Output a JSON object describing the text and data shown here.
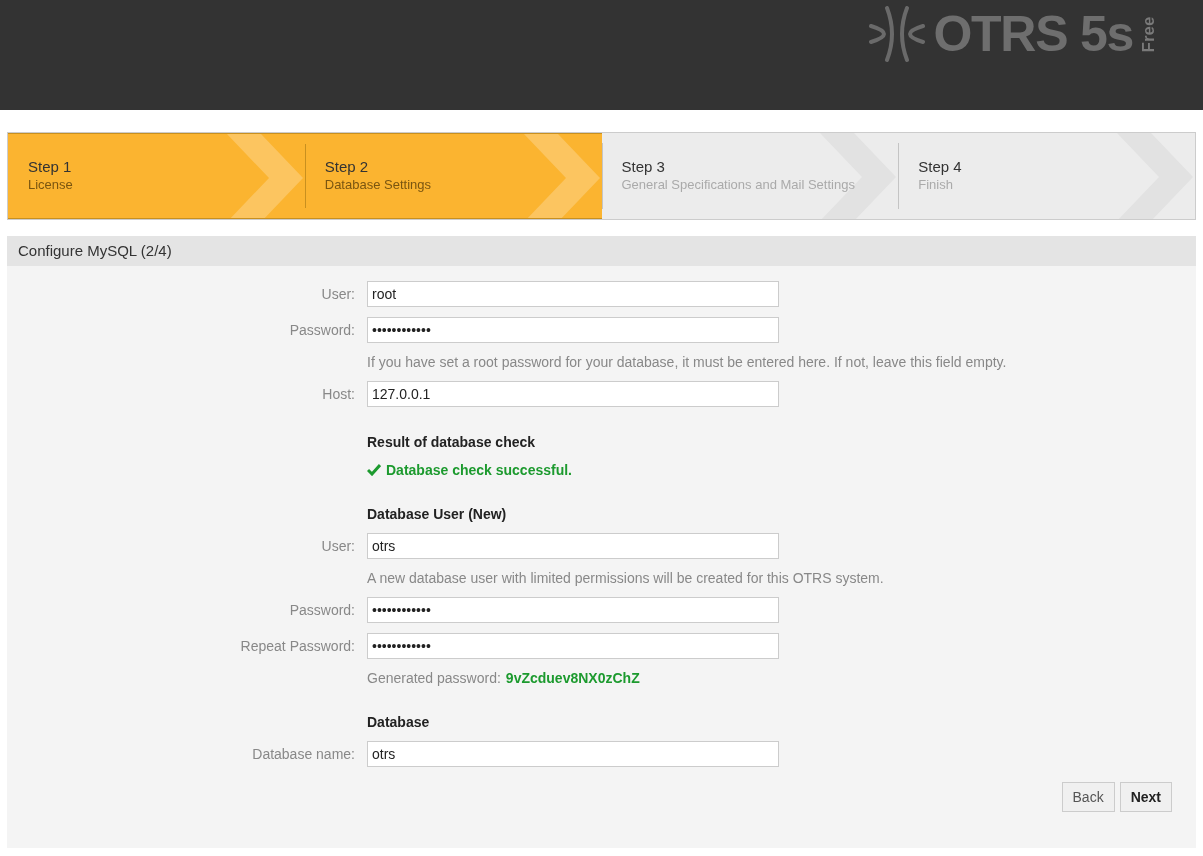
{
  "header": {
    "logo": {
      "name": "OTRS 5s",
      "edition": "Free"
    }
  },
  "steps": [
    {
      "title": "Step 1",
      "subtitle": "License",
      "active": true
    },
    {
      "title": "Step 2",
      "subtitle": "Database Settings",
      "active": true
    },
    {
      "title": "Step 3",
      "subtitle": "General Specifications and Mail Settings",
      "active": false
    },
    {
      "title": "Step 4",
      "subtitle": "Finish",
      "active": false
    }
  ],
  "panel": {
    "title": "Configure MySQL (2/4)",
    "items": [
      {
        "kind": "field",
        "label": "User:",
        "value": "root"
      },
      {
        "kind": "field",
        "label": "Password:",
        "value": "••••••••••••"
      },
      {
        "kind": "hint",
        "text": "If you have set a root password for your database, it must be entered here. If not, leave this field empty."
      },
      {
        "kind": "field",
        "label": "Host:",
        "value": "127.0.0.1"
      },
      {
        "kind": "heading",
        "text": "Result of database check"
      },
      {
        "kind": "status",
        "text": "Database check successful."
      },
      {
        "kind": "heading",
        "text": "Database User (New)"
      },
      {
        "kind": "field",
        "label": "User:",
        "value": "otrs"
      },
      {
        "kind": "hint",
        "text": "A new database user with limited permissions will be created for this OTRS system."
      },
      {
        "kind": "field",
        "label": "Password:",
        "value": "••••••••••••"
      },
      {
        "kind": "field",
        "label": "Repeat Password:",
        "value": "••••••••••••"
      },
      {
        "kind": "generated",
        "text": "Generated password:",
        "password": "9vZcduev8NX0zChZ"
      },
      {
        "kind": "heading",
        "text": "Database"
      },
      {
        "kind": "field",
        "label": "Database name:",
        "value": "otrs"
      }
    ],
    "buttons": [
      {
        "label": "Back",
        "primary": false
      },
      {
        "label": "Next",
        "primary": true
      }
    ]
  }
}
